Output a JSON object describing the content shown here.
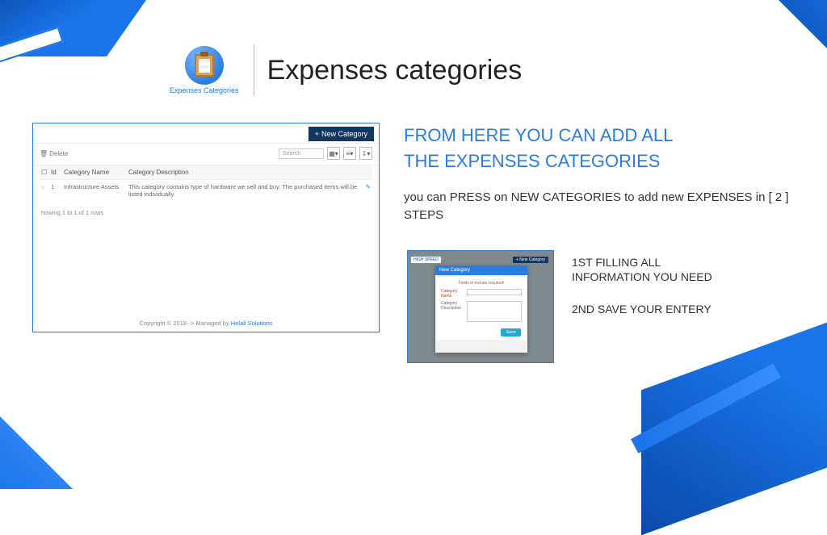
{
  "icon": {
    "label": "Expenses Categories"
  },
  "title": "Expenses categories",
  "headline_l1": "FROM HERE YOU CAN ADD ALL",
  "headline_l2": "THE EXPENSES CATEGORIES",
  "subline": "you can PRESS on NEW CATEGORIES to add new EXPENSES  in  [ 2  ] STEPS",
  "left_screenshot": {
    "new_category_btn": "New Category",
    "delete_label": "Delete",
    "search_placeholder": "Search",
    "columns": {
      "id": "Id",
      "name": "Category Name",
      "desc": "Category Description"
    },
    "row": {
      "id": "1",
      "name": "Infrastructure Assets",
      "desc": "This category contains type of hardware we sell and buy. The purchased items will be listed individually."
    },
    "showing": "howing 1 to 1 of 1 rows",
    "footer_prefix": "Copyright © 2018--> Managed by ",
    "footer_link": "Helali Solutions"
  },
  "mini": {
    "logo": "HIGH SPEED",
    "new_category_btn": "+ New Category",
    "modal_title": "New Category",
    "modal_warn": "Fields in red are required!",
    "label_name": "Category Name",
    "label_desc": "Category Description",
    "save": "Save"
  },
  "steps": {
    "s1": "1ST FILLING ALL INFORMATION YOU NEED",
    "s2": "2ND SAVE YOUR ENTERY"
  }
}
